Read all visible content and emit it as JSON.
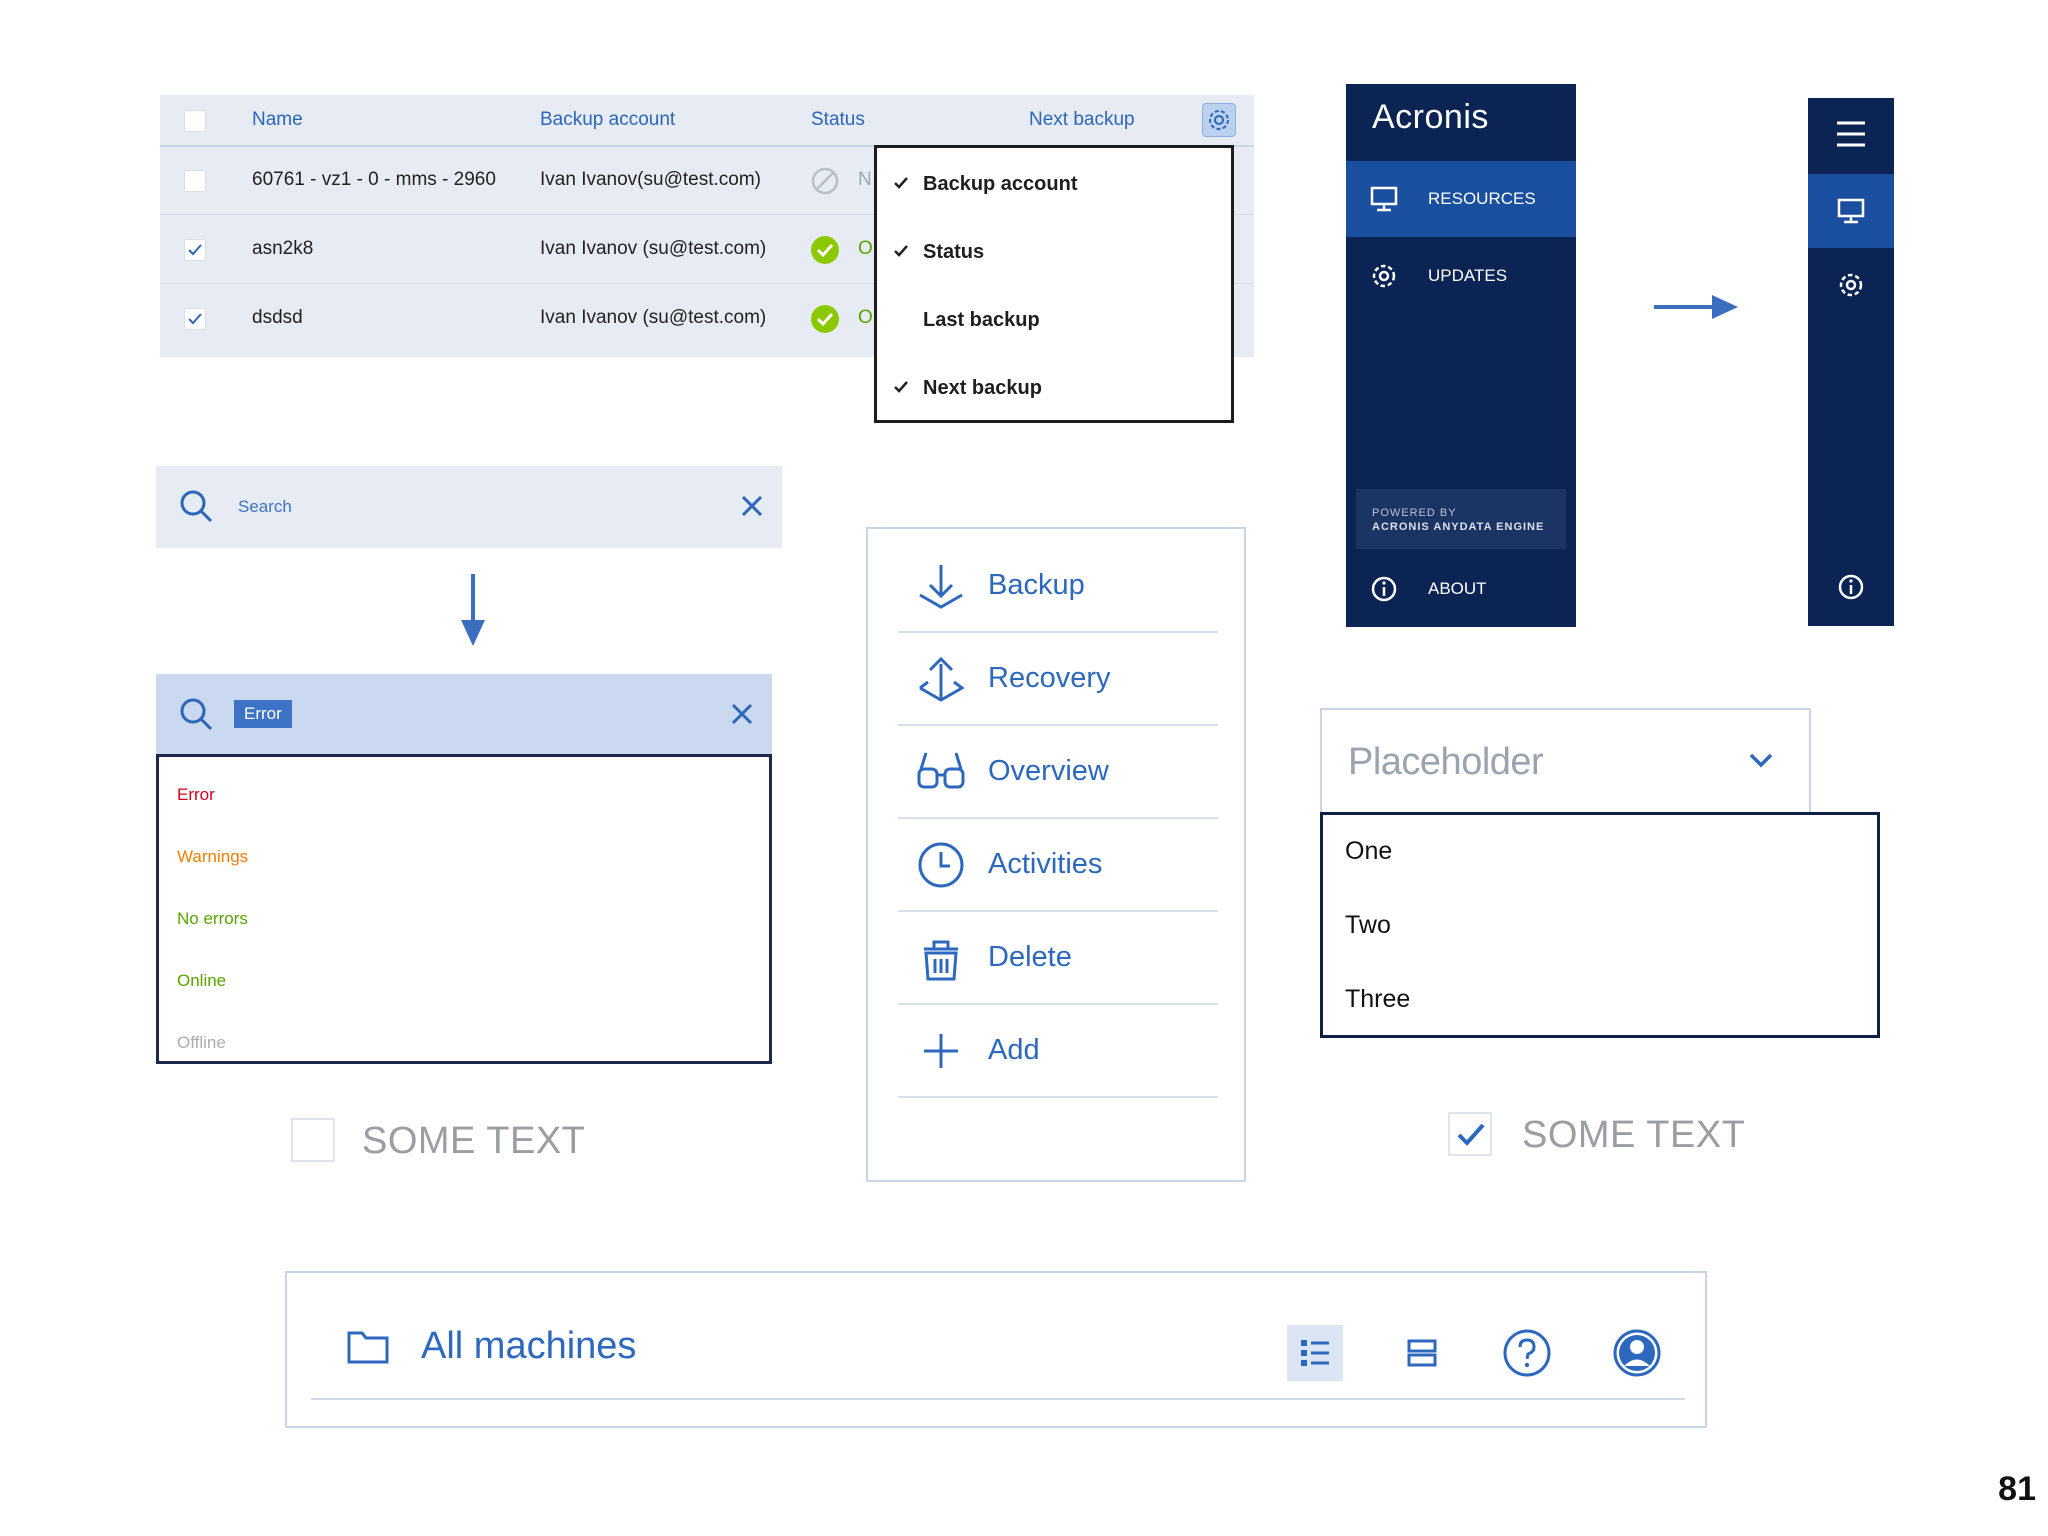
{
  "table": {
    "headers": {
      "name": "Name",
      "backup_account": "Backup account",
      "status": "Status",
      "next_backup": "Next backup"
    },
    "rows": [
      {
        "name": "60761 - vz1 - 0 - mms - 2960",
        "account": "Ivan Ivanov(su@test.com)",
        "status_clip": "N"
      },
      {
        "name": "asn2k8",
        "account": "Ivan Ivanov (su@test.com)",
        "status_clip": "O"
      },
      {
        "name": "dsdsd",
        "account": "Ivan Ivanov (su@test.com)",
        "status_clip": "O"
      }
    ]
  },
  "column_menu": {
    "items": [
      {
        "label": "Backup account",
        "checked": true
      },
      {
        "label": "Status",
        "checked": true
      },
      {
        "label": "Last backup",
        "checked": false
      },
      {
        "label": "Next backup",
        "checked": true
      }
    ]
  },
  "search": {
    "placeholder": "Search",
    "filter_chip": "Error"
  },
  "status_filter": {
    "options": [
      {
        "label": "Error",
        "color": "#d0021b"
      },
      {
        "label": "Warnings",
        "color": "#f07d00"
      },
      {
        "label": "No errors",
        "color": "#5aa300"
      },
      {
        "label": "Online",
        "color": "#5aa300"
      },
      {
        "label": "Offline",
        "color": "#a9adb3"
      }
    ]
  },
  "actions": {
    "items": [
      {
        "label": "Backup",
        "icon": "download-icon"
      },
      {
        "label": "Recovery",
        "icon": "recovery-icon"
      },
      {
        "label": "Overview",
        "icon": "glasses-icon"
      },
      {
        "label": "Activities",
        "icon": "clock-icon"
      },
      {
        "label": "Delete",
        "icon": "trash-icon"
      },
      {
        "label": "Add",
        "icon": "plus-icon"
      }
    ]
  },
  "sidebar": {
    "brand": "Acronis",
    "items": [
      {
        "label": "RESOURCES",
        "active": true
      },
      {
        "label": "UPDATES",
        "active": false
      }
    ],
    "powered_line1": "POWERED BY",
    "powered_line2": "ACRONIS ANYDATA ENGINE",
    "about": "ABOUT"
  },
  "select": {
    "placeholder": "Placeholder",
    "options": [
      "One",
      "Two",
      "Three"
    ]
  },
  "checkbox_unchecked": {
    "label": "SOME TEXT"
  },
  "checkbox_checked": {
    "label": "SOME TEXT"
  },
  "toolbar": {
    "title": "All machines"
  },
  "page_number": "81",
  "colors": {
    "accent": "#2d68bf",
    "navy": "#0c2454",
    "active": "#1a4f9f",
    "success": "#8cc800"
  }
}
